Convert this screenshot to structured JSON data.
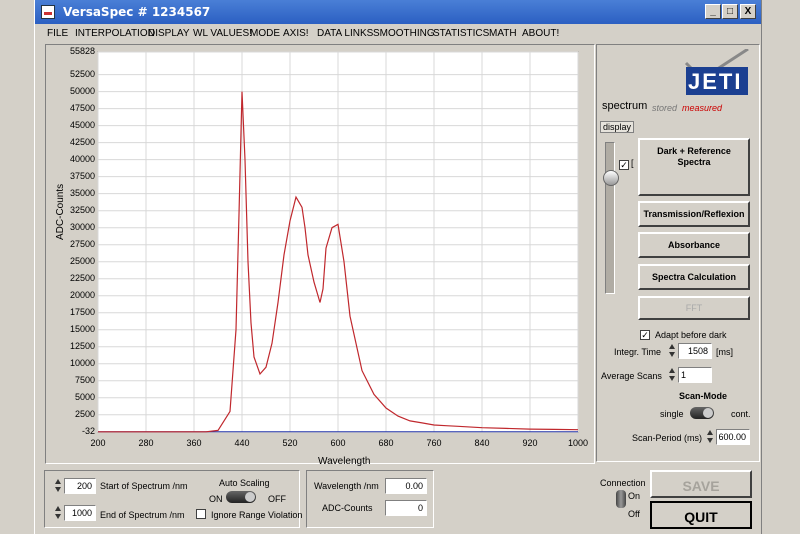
{
  "window": {
    "title": "VersaSpec # 1234567"
  },
  "title_buttons": {
    "minimize": "_",
    "maximize": "□",
    "close": "X"
  },
  "menu": [
    "FILE",
    "INTERPOLATION",
    "DISPLAY",
    "WL VALUES!",
    "MODE",
    "AXIS!",
    "DATA LINKS",
    "SMOOTHING",
    "STATISTICS",
    "MATH",
    "ABOUT!"
  ],
  "chart_data": {
    "type": "line",
    "title": "",
    "xlabel": "Wavelength",
    "ylabel": "ADC-Counts",
    "xlim": [
      200,
      1000
    ],
    "ylim": [
      -32,
      55828
    ],
    "x_ticks": [
      "200",
      "280",
      "360",
      "440",
      "520",
      "600",
      "680",
      "760",
      "840",
      "920",
      "1000"
    ],
    "y_ticks": [
      "55828",
      "52500",
      "50000",
      "47500",
      "45000",
      "42500",
      "40000",
      "37500",
      "35000",
      "32500",
      "30000",
      "27500",
      "25000",
      "22500",
      "20000",
      "17500",
      "15000",
      "12500",
      "10000",
      "7500",
      "5000",
      "2500",
      "-32"
    ],
    "series": [
      {
        "color": "#c0282d",
        "x": [
          200,
          380,
          400,
          420,
          430,
          435,
          440,
          445,
          450,
          455,
          460,
          470,
          480,
          490,
          500,
          510,
          520,
          530,
          540,
          545,
          550,
          560,
          570,
          575,
          580,
          590,
          600,
          610,
          620,
          640,
          660,
          680,
          700,
          720,
          740,
          760,
          780,
          800,
          840,
          880,
          920,
          960,
          1000
        ],
        "y": [
          0,
          0,
          200,
          3000,
          15000,
          32000,
          50000,
          40000,
          25000,
          16000,
          11000,
          8500,
          9500,
          13000,
          19000,
          26000,
          31000,
          34500,
          33000,
          30000,
          26000,
          22000,
          19000,
          21000,
          27000,
          30000,
          30500,
          25000,
          17000,
          9000,
          5500,
          3500,
          2300,
          1600,
          1300,
          1000,
          900,
          800,
          600,
          500,
          400,
          350,
          300
        ]
      }
    ]
  },
  "right_panel": {
    "logo_text": "JETI",
    "spectrum_label": "spectrum",
    "stored_label": "stored",
    "measured_label": "measured",
    "display_label": "display",
    "buttons": {
      "dark_ref": "Dark + Reference Spectra",
      "transmission": "Transmission/Reflexion",
      "absorbance": "Absorbance",
      "spectra_calc": "Spectra Calculation",
      "fft": "FFT"
    },
    "adapt_label": "Adapt before dark",
    "adapt_checked": "✓",
    "integr_label": "Integr. Time",
    "integr_value": "1508",
    "integr_unit": "[ms]",
    "avg_label": "Average Scans",
    "avg_value": "1",
    "scan_mode_label": "Scan-Mode",
    "single_label": "single",
    "cont_label": "cont.",
    "period_label": "Scan-Period (ms)",
    "period_value": "600.00"
  },
  "bottom": {
    "start_value": "200",
    "start_label": "Start of Spectrum /nm",
    "end_value": "1000",
    "end_label": "End of Spectrum /nm",
    "auto_scaling": "Auto Scaling",
    "on_label": "ON",
    "off_label": "OFF",
    "ignore_label": "Ignore Range Violation",
    "wavelength_label": "Wavelength /nm",
    "wavelength_value": "0.00",
    "adc_label": "ADC-Counts",
    "adc_value": "0",
    "connection_label": "Connection",
    "conn_on": "On",
    "conn_off": "Off",
    "save_label": "SAVE",
    "quit_label": "QUIT"
  }
}
